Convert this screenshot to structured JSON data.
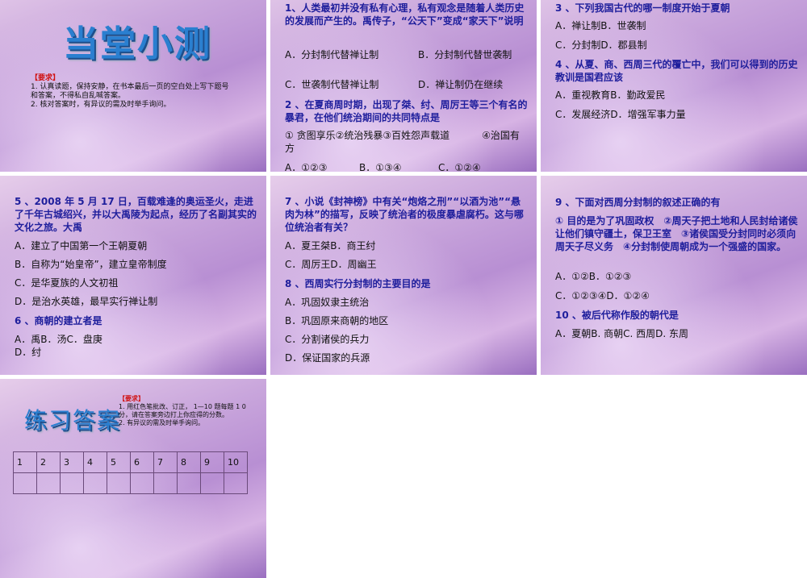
{
  "slides": [
    {
      "title": "当堂小测",
      "req_label": "【要求】",
      "req_lines": [
        "1. 认真读题，保持安静，在书本最后一页的空白处上写下题号和答案，不得私自乱喊答案。",
        "2. 核对答案时，有异议的需及时举手询问。"
      ]
    },
    {
      "q1": "1、人类最初并没有私有心理，私有观念是随着人类历史的发展而产生的。禹传子，“公天下”变成“家天下”说明",
      "q1_opts": [
        "A．分封制代替禅让制",
        "B．分封制代替世袭制",
        "C．世袭制代替禅让制",
        "D．禅让制仍在继续"
      ],
      "q2": "2 、在夏商周时期，出现了桀、纣、周厉王等三个有名的暴君，在他们统治期间的共同特点是",
      "q2_items": [
        "① 贪图享乐",
        "②统治残暴",
        "③百姓怨声载道",
        "④治国有方"
      ],
      "q2_opts": [
        "A．①②③",
        "B．①③④",
        "C．①②④"
      ]
    },
    {
      "q3": "3 、下列我国古代的哪一制度开始于夏朝",
      "q3_opts": [
        "A．禅让制",
        "B．世袭制",
        "C．分封制",
        "D．郡县制"
      ],
      "q4": "4 、从夏、商、西周三代的覆亡中，我们可以得到的历史教训是国君应该",
      "q4_opts": [
        "A．重视教育",
        "B．勤政爱民",
        "C．发展经济",
        "D．增强军事力量"
      ]
    },
    {
      "q5": "5 、2008 年 5 月 17 日，百载难逢的奥运圣火，走进了千年古城绍兴，并以大禹陵为起点，经历了名副其实的文化之旅。大禹",
      "q5_opts": [
        "A．建立了中国第一个王朝夏朝",
        "B．自称为“始皇帝”，建立皇帝制度",
        "C．是华夏族的人文初祖",
        "D．是治水英雄，最早实行禅让制"
      ],
      "q6": "6 、商朝的建立者是",
      "q6_opts": [
        "A．禹",
        "B．汤",
        "C．盘庚",
        "D．纣"
      ]
    },
    {
      "q7": "7 、小说《封神榜》中有关“炮烙之刑”“以酒为池”“悬肉为林”的描写，反映了统治者的极度暴虐腐朽。这与哪位统治者有关？",
      "q7_opts": [
        "A．夏王桀",
        "B．商王纣",
        "C．周厉王",
        "D．周幽王"
      ],
      "q8": "8 、西周实行分封制的主要目的是",
      "q8_opts": [
        "A．巩固奴隶主统治",
        "B．巩固原来商朝的地区",
        "C．分割诸侯的兵力",
        "D．保证国家的兵源"
      ]
    },
    {
      "q9": "9 、下面对西周分封制的叙述正确的有",
      "q9_items": "① 目的是为了巩固政权　②周天子把土地和人民封给诸侯让他们镇守疆土，保卫王室　③诸侯国受分封同时必须向周天子尽义务　④分封制使周朝成为一个强盛的国家。",
      "q9_opts": [
        "A．①②",
        "B．①②③",
        "C．①②③④",
        "D．①②④"
      ],
      "q10": "10 、被后代称作殷的朝代是",
      "q10_opts": [
        "A．夏朝",
        "B. 商朝",
        "C. 西周",
        "D. 东周"
      ]
    },
    {
      "title": "练习答案",
      "req_label": "【要求】",
      "req_lines": [
        "1. 用红色笔批改、订正， 1—10 题每题 1 0 分，请在答案旁边打上你应得的分数。",
        "2. 有异议的需及时举手询问。"
      ],
      "table_header": [
        "1",
        "2",
        "3",
        "4",
        "5",
        "6",
        "7",
        "8",
        "9",
        "10"
      ]
    }
  ]
}
